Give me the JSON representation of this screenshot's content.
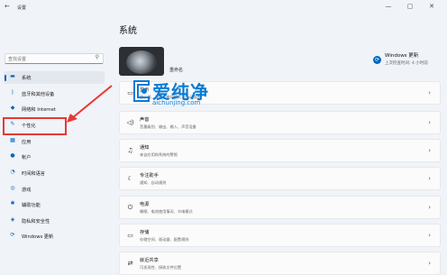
{
  "app": {
    "title": "设置",
    "back_glyph": "←",
    "min_glyph": "—",
    "max_glyph": "▢",
    "close_glyph": "✕"
  },
  "search": {
    "placeholder": "查找设置",
    "icon": "search-icon"
  },
  "sidebar": {
    "items": [
      {
        "label": "系统",
        "icon": "monitor-icon",
        "glyph": "▬",
        "active": true
      },
      {
        "label": "蓝牙和其他设备",
        "icon": "bluetooth-icon",
        "glyph": "ᛒ"
      },
      {
        "label": "网络和 Internet",
        "icon": "wifi-icon",
        "glyph": "◆"
      },
      {
        "label": "个性化",
        "icon": "brush-icon",
        "glyph": "✎"
      },
      {
        "label": "应用",
        "icon": "apps-icon",
        "glyph": "▦"
      },
      {
        "label": "帐户",
        "icon": "account-icon",
        "glyph": "●"
      },
      {
        "label": "时间和语言",
        "icon": "clock-globe-icon",
        "glyph": "◔"
      },
      {
        "label": "游戏",
        "icon": "gamepad-icon",
        "glyph": "◎"
      },
      {
        "label": "辅助功能",
        "icon": "accessibility-icon",
        "glyph": "✱"
      },
      {
        "label": "隐私和安全性",
        "icon": "shield-icon",
        "glyph": "◈"
      },
      {
        "label": "Windows 更新",
        "icon": "update-icon",
        "glyph": "⟳"
      }
    ]
  },
  "main": {
    "title": "系统",
    "pc_name": "重命名",
    "update": {
      "title": "Windows 更新",
      "subtitle": "上次检查时间: 4 小时前",
      "icon": "sync-icon",
      "glyph": "⟳"
    },
    "cards": [
      {
        "title": "显示",
        "subtitle": "显示器、亮度、夜间模式、显示描述",
        "icon": "display-icon",
        "glyph": "▭"
      },
      {
        "title": "声音",
        "subtitle": "音量级别、输出、输入、声音设备",
        "icon": "speaker-icon",
        "glyph": "◁)"
      },
      {
        "title": "通知",
        "subtitle": "来自应用和系统的警报",
        "icon": "bell-icon",
        "glyph": "♫"
      },
      {
        "title": "专注助手",
        "subtitle": "通知、自动规则",
        "icon": "moon-icon",
        "glyph": "☾"
      },
      {
        "title": "电源",
        "subtitle": "睡眠、电池使用情况、节电模式",
        "icon": "power-icon",
        "glyph": "⏻"
      },
      {
        "title": "存储",
        "subtitle": "存储空间、驱动器、配置规则",
        "icon": "storage-icon",
        "glyph": "▭"
      },
      {
        "title": "就近共享",
        "subtitle": "可发现性、接收文件位置",
        "icon": "share-icon",
        "glyph": "⇄"
      }
    ],
    "chevron": "›"
  },
  "watermark": {
    "big": "爱纯净",
    "small": "aichunjing.com"
  },
  "colors": {
    "accent": "#0067c0",
    "highlight": "#e53935",
    "watermark": "#0a7bd4"
  }
}
